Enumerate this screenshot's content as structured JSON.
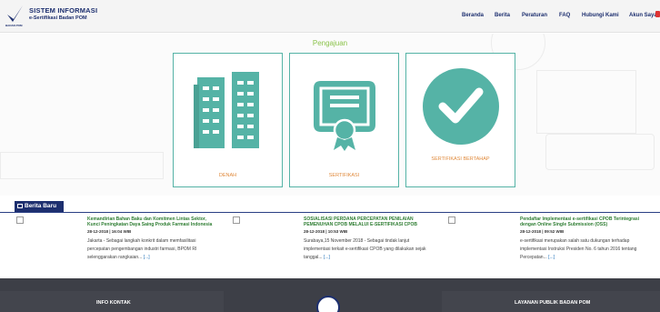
{
  "header": {
    "logo_caption": "BADAN POM",
    "title": "SISTEM INFORMASI",
    "subtitle": "e-Sertifikasi Badan POM",
    "nav": [
      {
        "label": "Beranda"
      },
      {
        "label": "Berita"
      },
      {
        "label": "Peraturan"
      },
      {
        "label": "FAQ"
      },
      {
        "label": "Hubungi Kami"
      },
      {
        "label": "Akun Saya"
      }
    ]
  },
  "hero": {
    "title": "Pengajuan",
    "cards": [
      {
        "label": "DENAH",
        "icon": "buildings-icon"
      },
      {
        "label": "SERTIFIKASI",
        "icon": "certificate-icon"
      },
      {
        "label": "SERTIFIKASI BERTAHAP",
        "icon": "checkmark-circle-icon"
      }
    ]
  },
  "news": {
    "heading": "Berita Baru",
    "items": [
      {
        "title": "Kemandirian Bahan Baku dan Komitmen Lintas Sektor, Kunci Peningkatan Daya Saing Produk Farmasi Indonesia",
        "date": "28-12-2018 | 16:04 WIB",
        "body": "Jakarta - Sebagai langkah konkrit dalam memfasilitasi percepatan pengembangan industri farmasi, BPOM RI selenggarakan rangkaian...",
        "more": "[...]"
      },
      {
        "title": "SOSIALISASI PERDANA PERCEPATAN PENILAIAN PEMENUHAN CPOB MELALUI E-SERTIFIKASI CPOB",
        "date": "28-12-2018 | 10:53 WIB",
        "body": "Surabaya,15 November 2018 - Sebagai tindak lanjut implementasi terkait e-sertifikasi CPOB yang dilakukan sejak tanggal...",
        "more": "[...]"
      },
      {
        "title": "Pendaftar Implementasi e-sertifikasi CPOB Terintegrasi dengan Online Single Submission (OSS)",
        "date": "28-12-2018 | 09:52 WIB",
        "body": "e-sertifikasi merupakan salah satu dukungan terhadap implementasi Instruksi Presiden No. 6 tahun 2016 tentang Percepatan...",
        "more": "[...]"
      }
    ]
  },
  "footer": {
    "left_title": "INFO KONTAK",
    "right_title": "LAYANAN PUBLIK BADAN POM"
  },
  "colors": {
    "navy": "#1d2f6f",
    "teal": "#55b3a6",
    "orange": "#e08a3c",
    "green": "#8bc34a",
    "footer": "#3d3f47"
  }
}
